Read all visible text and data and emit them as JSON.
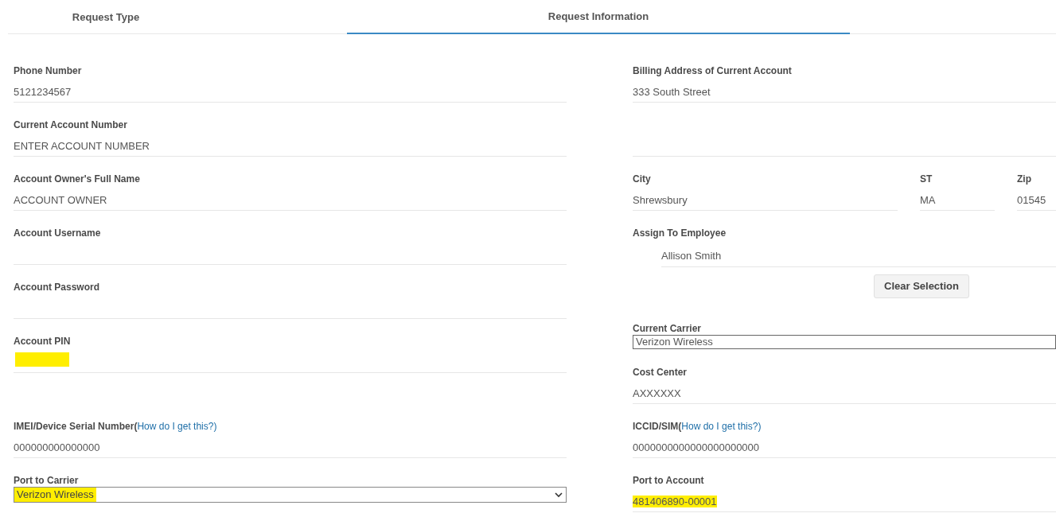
{
  "tabs": [
    {
      "label": "Request Type",
      "selected": false
    },
    {
      "label": "Request Information",
      "selected": true
    }
  ],
  "upper_left": [
    {
      "kind": "text",
      "label": "Phone Number",
      "value": "5121234567"
    },
    {
      "kind": "text",
      "label": "Current Account Number",
      "value": "ENTER ACCOUNT NUMBER"
    },
    {
      "kind": "text",
      "label": "Account Owner's Full Name",
      "value": "ACCOUNT OWNER"
    },
    {
      "kind": "text",
      "label": "Account Username"
    },
    {
      "kind": "text",
      "label": "Account Password"
    },
    {
      "kind": "text",
      "label": "Account PIN",
      "highlighted": true
    }
  ],
  "upper_right": [
    {
      "kind": "text",
      "label": "Billing Address of Current Account",
      "value": "333 South Street"
    },
    {
      "kind": "blank"
    },
    {
      "kind": "triple",
      "parts": [
        {
          "label": "City",
          "value": "Shrewsbury"
        },
        {
          "label": "ST",
          "value": "MA"
        },
        {
          "label": "Zip",
          "value": "01545"
        }
      ]
    },
    {
      "kind": "indented",
      "label": "Assign To Employee",
      "value": "Allison Smith"
    },
    {
      "kind": "button",
      "label": "Clear Selection"
    },
    {
      "kind": "box",
      "label": "Current Carrier",
      "value": "Verizon Wireless"
    },
    {
      "kind": "text",
      "label": "Cost Center",
      "value": "AXXXXXX"
    }
  ],
  "lower_rows": [
    [
      {
        "kind": "text",
        "label": "IMEI/Device Serial Number(",
        "link": "How do I get this?)",
        "value": "000000000000000"
      },
      {
        "kind": "text",
        "label": "ICCID/SIM(",
        "link": "How do I get this?)",
        "value": "0000000000000000000000"
      }
    ],
    [
      {
        "kind": "select",
        "label": "Port to Carrier",
        "value": "Verizon Wireless",
        "highlighted": true
      },
      {
        "kind": "text",
        "label": "Port to Account",
        "value": "481406890-00001",
        "highlighted": true
      }
    ]
  ]
}
